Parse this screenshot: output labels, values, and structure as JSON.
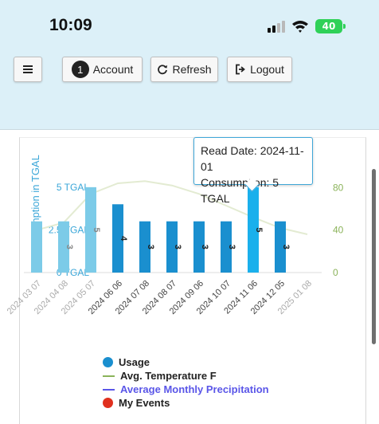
{
  "status_bar": {
    "time": "10:09",
    "battery": "40"
  },
  "toolbar": {
    "account_count": "1",
    "account_label": "Account",
    "refresh_label": "Refresh",
    "logout_label": "Logout"
  },
  "icons": [
    "menu-icon",
    "refresh-icon",
    "logout-icon",
    "signal-icon",
    "wifi-icon",
    "battery-icon"
  ],
  "colors": {
    "header_bg": "#dcf0f8",
    "usage_bar": "#1a8fcf",
    "usage_bar_highlight": "#1ab0ec",
    "usage_bar_faded": "#7ccbe8",
    "temperature": "#8bb35a",
    "precipitation": "#5a56e8",
    "events": "#e0301e"
  },
  "tooltip": {
    "line1": "Read Date: 2024-11-01",
    "line2": "Consumption: 5 TGAL"
  },
  "chart_data": {
    "type": "bar",
    "ylabel": "Consumption in TGAL",
    "y_tick_labels": [
      "0 TGAL",
      "2.5 TGAL",
      "5 TGAL"
    ],
    "y_ticks": [
      0,
      2.5,
      5
    ],
    "ylim": [
      0,
      5.6
    ],
    "y2_ticks": [
      "0",
      "40",
      "80"
    ],
    "y2lim": [
      0,
      90
    ],
    "categories": [
      "2024 03 07",
      "2024 04 08",
      "2024 05 07",
      "2024 06 06",
      "2024 07 08",
      "2024 08 07",
      "2024 09 06",
      "2024 10 07",
      "2024 11 06",
      "2024 12 05",
      "2025 01 08"
    ],
    "series": [
      {
        "name": "Usage",
        "values": [
          3,
          3,
          5,
          4,
          3,
          3,
          3,
          3,
          5,
          3,
          3
        ],
        "labels": [
          "",
          "3",
          "5",
          "4",
          "3",
          "3",
          "3",
          "3",
          "5",
          "3",
          "3"
        ]
      },
      {
        "name": "Avg. Temperature F",
        "values": [
          40,
          47,
          74,
          84,
          86,
          82,
          74,
          63,
          52,
          42,
          36
        ]
      }
    ],
    "legend": [
      {
        "label": "Usage",
        "kind": "dot",
        "color": "#1a8fcf"
      },
      {
        "label": "Avg. Temperature F",
        "kind": "line",
        "color": "#8bb35a"
      },
      {
        "label": "Average Monthly Precipitation",
        "kind": "line",
        "color": "#5a56e8"
      },
      {
        "label": "My Events",
        "kind": "dot",
        "color": "#e0301e"
      }
    ],
    "legend_position": "bottom"
  }
}
